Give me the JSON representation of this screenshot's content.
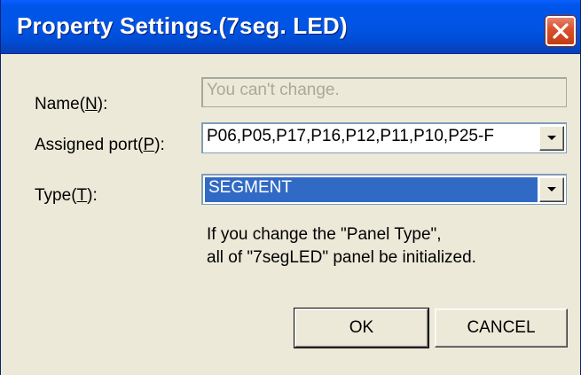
{
  "window": {
    "title": "Property Settings.(7seg. LED)"
  },
  "form": {
    "name_label_pre": "Name(",
    "name_label_key": "N",
    "name_label_post": "):",
    "name_value": "You can't change.",
    "port_label_pre": "Assigned port(",
    "port_label_key": "P",
    "port_label_post": "):",
    "port_value": "P06,P05,P17,P16,P12,P11,P10,P25-F",
    "type_label_pre": "Type(",
    "type_label_key": "T",
    "type_label_post": "):",
    "type_value": "SEGMENT"
  },
  "info": {
    "line1": "If you change the \"Panel Type\",",
    "line2": "all of \"7segLED\" panel be initialized."
  },
  "buttons": {
    "ok_label": "OK",
    "cancel_label": "CANCEL"
  },
  "icons": {
    "close": "close-x-icon",
    "dropdown": "chevron-down-icon"
  },
  "colors": {
    "titlebar": "#0055E5",
    "close_button": "#D9542F",
    "window_bg": "#ECE9D8",
    "selection": "#316AC5"
  }
}
